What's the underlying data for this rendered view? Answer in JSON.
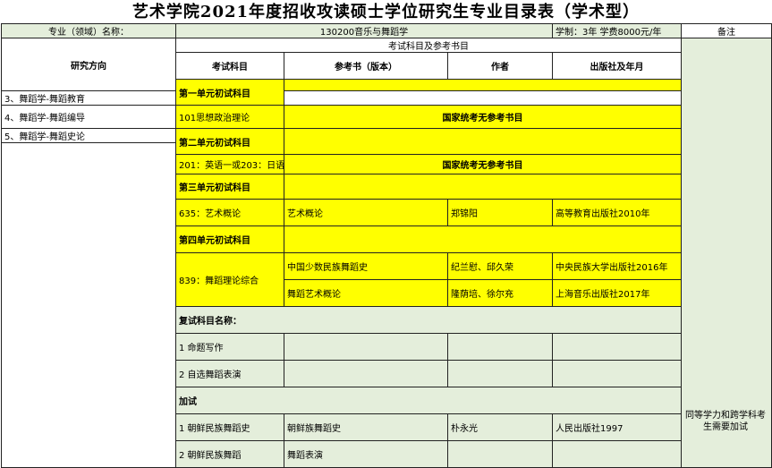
{
  "title": "艺术学院2021年度招收攻读硕士学位研究生专业目录表（学术型）",
  "header": {
    "major_label": "专业（领域）名称：",
    "major_value": "130200音乐与舞蹈学",
    "duration": "学制：3年  学费8000元/年",
    "remarks": "备注"
  },
  "columns": {
    "subjects_group": "考试科目及参考书目",
    "research": "研究方向",
    "subject": "考试科目",
    "book": "参考书（版本）",
    "author": "作者",
    "publisher": "出版社及年月"
  },
  "directions": [
    "3、舞蹈学-舞蹈教育",
    "4、舞蹈学-舞蹈编导",
    "5、舞蹈学-舞蹈史论"
  ],
  "unit1": {
    "label": "第一单元初试科目",
    "subject": "101思想政治理论",
    "note": "国家统考无参考书目"
  },
  "unit2": {
    "label": "第二单元初试科目",
    "subject": "201：英语一或203：日语",
    "note": "国家统考无参考书目"
  },
  "unit3": {
    "label": "第三单元初试科目",
    "subject": "635：艺术概论",
    "book": "艺术概论",
    "author": "郑锦阳",
    "publisher": "高等教育出版社2010年"
  },
  "unit4": {
    "label": "第四单元初试科目",
    "subject": "839：舞蹈理论综合",
    "books": [
      {
        "book": "中国少数民族舞蹈史",
        "author": "纪兰慰、邱久荣",
        "publisher": "中央民族大学出版社2016年"
      },
      {
        "book": "舞蹈艺术概论",
        "author": "隆荫培、徐尔充",
        "publisher": "上海音乐出版社2017年"
      }
    ]
  },
  "retest": {
    "label": "复试科目名称：",
    "items": [
      "1  命题写作",
      "2  自选舞蹈表演"
    ]
  },
  "extra": {
    "label": "加试",
    "items": [
      {
        "subject": "1  朝鲜民族舞蹈史",
        "book": "朝鲜族舞蹈史",
        "author": "朴永光",
        "publisher": "人民出版社1997"
      },
      {
        "subject": "2  朝鲜民族舞蹈",
        "book": "舞蹈表演",
        "author": "",
        "publisher": ""
      }
    ],
    "note": "同等学力和跨学科考生需要加试"
  }
}
